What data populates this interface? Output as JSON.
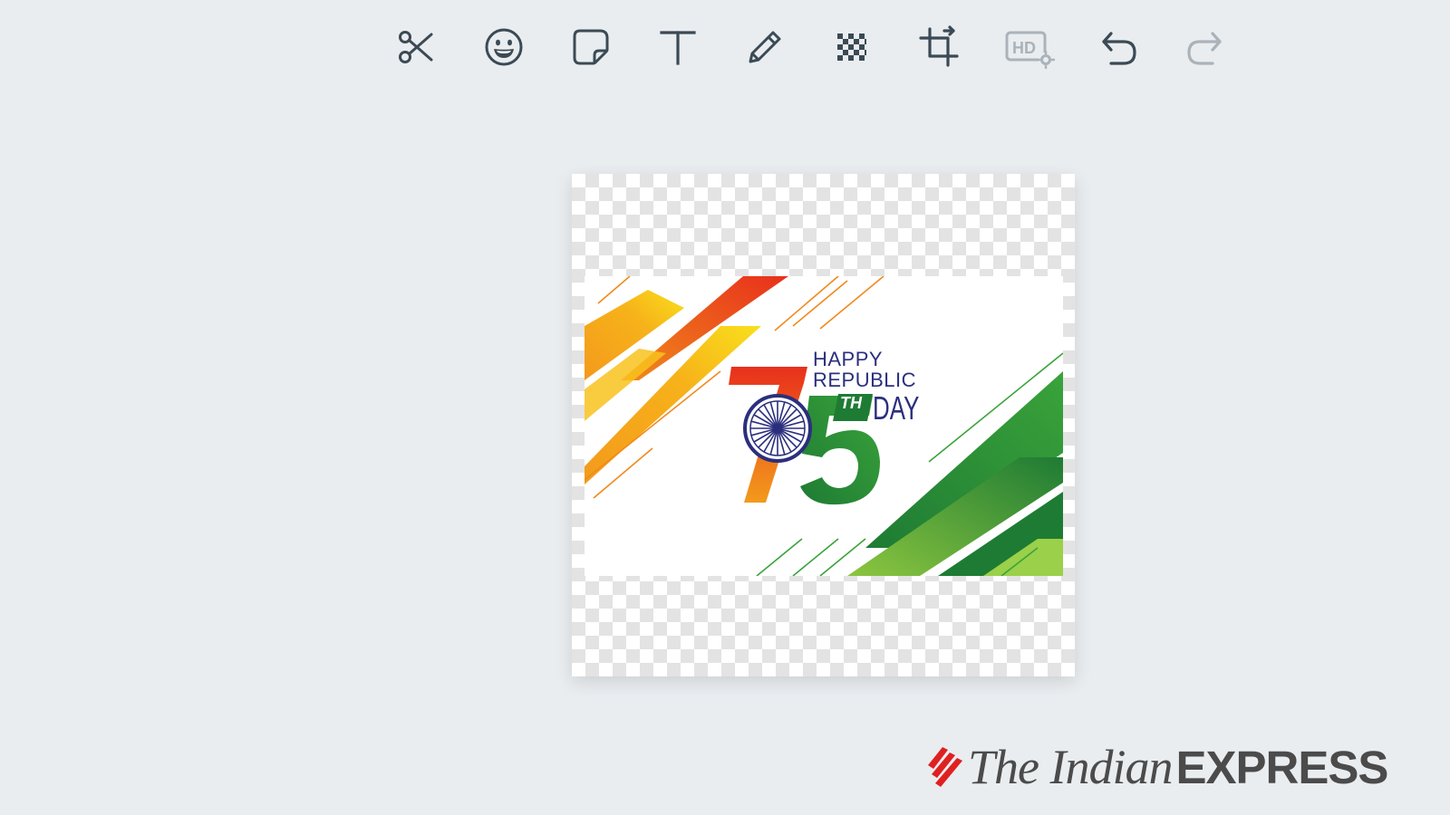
{
  "toolbar": {
    "tools": [
      {
        "name": "cut",
        "icon": "scissors-icon",
        "enabled": true
      },
      {
        "name": "emoji",
        "icon": "emoji-icon",
        "enabled": true
      },
      {
        "name": "sticker",
        "icon": "sticker-icon",
        "enabled": true
      },
      {
        "name": "text",
        "icon": "text-icon",
        "enabled": true
      },
      {
        "name": "draw",
        "icon": "pencil-icon",
        "enabled": true
      },
      {
        "name": "blur",
        "icon": "mosaic-icon",
        "enabled": true
      },
      {
        "name": "crop",
        "icon": "crop-icon",
        "enabled": true
      },
      {
        "name": "hd",
        "icon": "hd-settings-icon",
        "label": "HD",
        "enabled": false
      },
      {
        "name": "undo",
        "icon": "undo-icon",
        "enabled": true
      },
      {
        "name": "redo",
        "icon": "redo-icon",
        "enabled": false
      }
    ],
    "icon_color": "#3b4a54",
    "disabled_color": "#aab3b9"
  },
  "image": {
    "greeting_line1": "HAPPY",
    "greeting_line2": "REPUBLIC",
    "day": "DAY",
    "number": "75",
    "suffix": "TH",
    "colors": {
      "saffron": "#f39a1c",
      "red": "#e8301c",
      "green": "#1e7b34",
      "navy": "#2b2f7d"
    }
  },
  "watermark": {
    "brand_part1": "The Indian",
    "brand_part2": "EXPRESS",
    "accent": "#e02020"
  },
  "theme": {
    "background": "#e9edf0"
  }
}
